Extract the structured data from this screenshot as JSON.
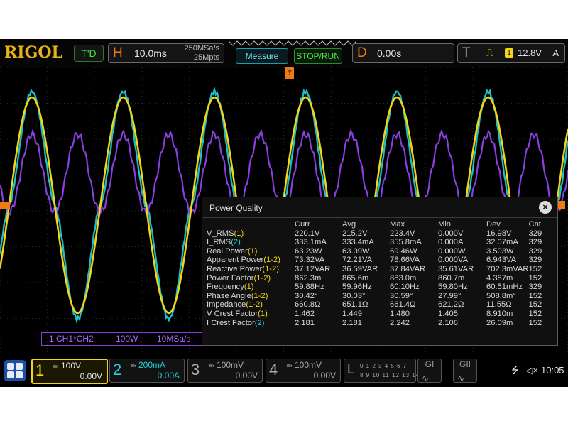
{
  "brand": "RIGOL",
  "status": "T'D",
  "horizontal": {
    "letter": "H",
    "timebase": "10.0ms",
    "sample_rate": "250MSa/s",
    "memory_depth": "25Mpts"
  },
  "buttons": {
    "measure": "Measure",
    "stop_run": "STOP/RUN"
  },
  "delay": {
    "letter": "D",
    "value": "0.00s"
  },
  "trigger": {
    "letter": "T",
    "slope_icon": "rising-edge-icon",
    "source": "1",
    "level": "12.8V",
    "mode": "A",
    "marker": "T"
  },
  "math_label": {
    "channel": "1 CH1*CH2",
    "scale": "100W",
    "rate": "10MSa/s"
  },
  "power_quality": {
    "title": "Power Quality",
    "close": "×",
    "columns": [
      "",
      "Curr",
      "Avg",
      "Max",
      "Min",
      "Dev",
      "Cnt"
    ],
    "rows": [
      {
        "name": "V_RMS",
        "src": "(1)",
        "srcColor": "ch1",
        "values": [
          "220.1V",
          "215.2V",
          "223.4V",
          "0.000V",
          "16.98V",
          "329"
        ]
      },
      {
        "name": "I_RMS",
        "src": "(2)",
        "srcColor": "ch2",
        "values": [
          "333.1mA",
          "333.4mA",
          "355.8mA",
          "0.000A",
          "32.07mA",
          "329"
        ]
      },
      {
        "name": "Real Power",
        "src": "(1)",
        "srcColor": "ch1",
        "values": [
          "63.23W",
          "63.09W",
          "69.46W",
          "0.000W",
          "3.503W",
          "329"
        ]
      },
      {
        "name": "Apparent Power",
        "src": "(1-2)",
        "srcColor": "ch1",
        "values": [
          "73.32VA",
          "72.21VA",
          "78.66VA",
          "0.000VA",
          "6.943VA",
          "329"
        ]
      },
      {
        "name": "Reactive Power",
        "src": "(1-2)",
        "srcColor": "ch1",
        "values": [
          "37.12VAR",
          "36.59VAR",
          "37.84VAR",
          "35.61VAR",
          "702.3mVAR",
          "152"
        ]
      },
      {
        "name": "Power Factor",
        "src": "(1-2)",
        "srcColor": "ch1",
        "values": [
          "862.3m",
          "865.6m",
          "883.0m",
          "860.7m",
          "4.387m",
          "152"
        ]
      },
      {
        "name": "Frequency",
        "src": "(1)",
        "srcColor": "ch1",
        "values": [
          "59.88Hz",
          "59.96Hz",
          "60.10Hz",
          "59.80Hz",
          "60.51mHz",
          "329"
        ]
      },
      {
        "name": "Phase Angle",
        "src": "(1-2)",
        "srcColor": "ch1",
        "values": [
          "30.42°",
          "30.03°",
          "30.59°",
          "27.99°",
          "508.8m°",
          "152"
        ]
      },
      {
        "name": "Impedance",
        "src": "(1-2)",
        "srcColor": "ch1",
        "values": [
          "660.8Ω",
          "651.1Ω",
          "661.4Ω",
          "621.2Ω",
          "11.55Ω",
          "152"
        ]
      },
      {
        "name": "V Crest Factor",
        "src": "(1)",
        "srcColor": "ch1",
        "values": [
          "1.462",
          "1.449",
          "1.480",
          "1.405",
          "8.910m",
          "152"
        ]
      },
      {
        "name": "I Crest Factor",
        "src": "(2)",
        "srcColor": "ch2",
        "values": [
          "2.181",
          "2.181",
          "2.242",
          "2.106",
          "26.09m",
          "152"
        ]
      }
    ]
  },
  "channels": [
    {
      "num": "1",
      "scale": "100V",
      "offset": "0.00V",
      "color": "#f2d516"
    },
    {
      "num": "2",
      "scale": "200mA",
      "offset": "0.00A",
      "color": "#21d4e0"
    },
    {
      "num": "3",
      "scale": "100mV",
      "offset": "0.00V",
      "color": "#aaaaaa"
    },
    {
      "num": "4",
      "scale": "100mV",
      "offset": "0.00V",
      "color": "#aaaaaa"
    }
  ],
  "logic": {
    "letter": "L",
    "digits_top": "0 1 2 3 4 5 6 7",
    "digits_bottom": "8 9 10 11 12 13 14 15"
  },
  "generators": [
    {
      "label": "GI"
    },
    {
      "label": "GII"
    }
  ],
  "system": {
    "usb_icon": "usb-icon",
    "sound_icon": "speaker-mute-icon",
    "time": "10:05"
  },
  "colors": {
    "ch1": "#f2d516",
    "ch2": "#21d4e0",
    "math": "#8a3fe0",
    "trigger": "#f07a12"
  }
}
